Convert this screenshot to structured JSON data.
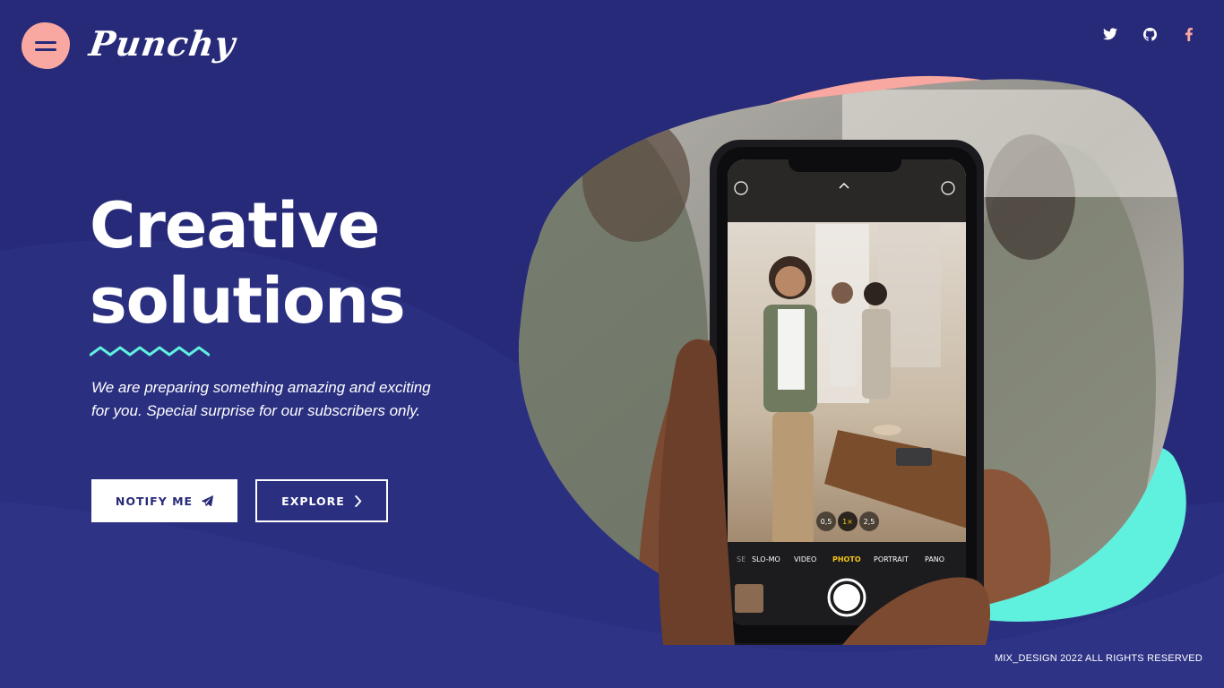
{
  "brand": {
    "logo_text": "Punchy"
  },
  "header": {
    "menu_icon": "hamburger-icon",
    "social": [
      {
        "name": "twitter",
        "icon": "twitter-icon",
        "color": "#ffffff"
      },
      {
        "name": "github",
        "icon": "github-icon",
        "color": "#ffffff"
      },
      {
        "name": "facebook",
        "icon": "facebook-icon",
        "color": "#f8a8a0"
      }
    ]
  },
  "hero": {
    "title_line1": "Creative",
    "title_line2": "solutions",
    "subtitle": "We are preparing something amazing and exciting for you. Special surprise for our subscribers only.",
    "notify_label": "NOTIFY ME",
    "notify_icon": "paper-plane-icon",
    "explore_label": "EXPLORE",
    "explore_icon": "chevron-right-icon"
  },
  "camera_ui": {
    "modes": [
      "SE",
      "SLO-MO",
      "VIDEO",
      "PHOTO",
      "PORTRAIT",
      "PANO"
    ],
    "active_mode": "PHOTO",
    "zoom_levels": [
      "0,5",
      "1×",
      "2,5"
    ]
  },
  "footer": {
    "copyright": "MIX_DESIGN 2022 ALL RIGHTS RESERVED"
  },
  "colors": {
    "background": "#272a78",
    "wave": "#2e3384",
    "accent_pink": "#f8a8a0",
    "accent_teal": "#5ff0de",
    "white": "#ffffff",
    "camera_active": "#f5c518"
  }
}
